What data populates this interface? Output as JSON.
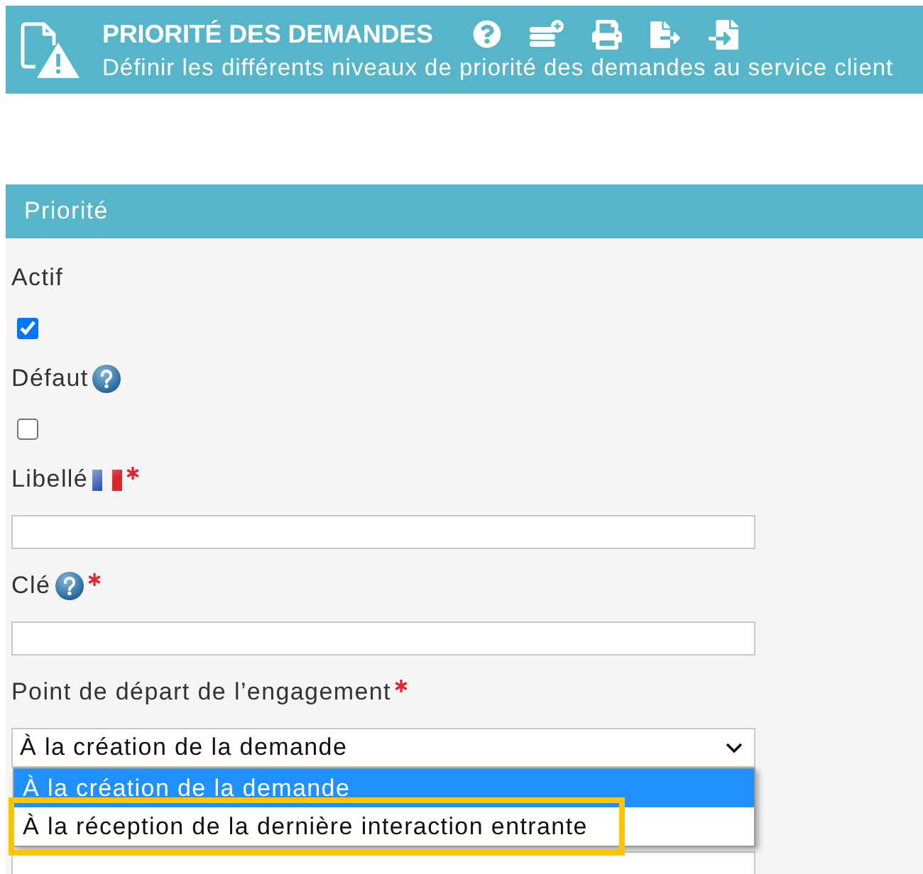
{
  "header": {
    "title": "PRIORITÉ DES DEMANDES",
    "subtitle": "Définir les différents niveaux de priorité des demandes au service client"
  },
  "panel": {
    "title": "Priorité",
    "fields": [
      {
        "kind": "checkbox",
        "label": "Actif",
        "checked": true
      },
      {
        "kind": "checkbox",
        "label": "Défaut",
        "help": true,
        "checked": false
      },
      {
        "kind": "text",
        "label": "Libellé",
        "translatable": true,
        "required": true
      },
      {
        "kind": "text",
        "label": "Clé",
        "help": true,
        "required": true
      },
      {
        "kind": "select",
        "label": "Point de départ de l’engagement",
        "required": true,
        "value": "À la création de la demande",
        "expanded": true,
        "options": [
          {
            "label": "À la création de la demande",
            "selected": true,
            "highlighted": false
          },
          {
            "label": "À la réception de la dernière interaction entrante",
            "selected": false,
            "highlighted": true
          }
        ]
      },
      {
        "kind": "text"
      }
    ]
  }
}
